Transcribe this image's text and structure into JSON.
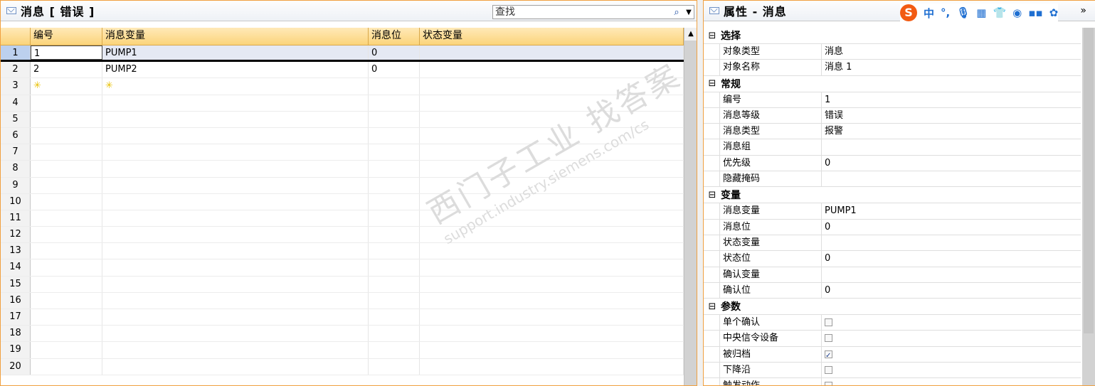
{
  "left": {
    "title": "消息 [ 错误 ]",
    "search_placeholder": "查找",
    "columns": [
      "编号",
      "消息变量",
      "消息位",
      "状态变量"
    ],
    "rows": [
      {
        "n": "1",
        "no": "1",
        "var": "PUMP1",
        "bit": "0",
        "state": ""
      },
      {
        "n": "2",
        "no": "2",
        "var": "PUMP2",
        "bit": "0",
        "state": ""
      },
      {
        "n": "3",
        "no": "",
        "var": "",
        "bit": "",
        "state": ""
      },
      {
        "n": "4"
      },
      {
        "n": "5"
      },
      {
        "n": "6"
      },
      {
        "n": "7"
      },
      {
        "n": "8"
      },
      {
        "n": "9"
      },
      {
        "n": "10"
      },
      {
        "n": "11"
      },
      {
        "n": "12"
      },
      {
        "n": "13"
      },
      {
        "n": "14"
      },
      {
        "n": "15"
      },
      {
        "n": "16"
      },
      {
        "n": "17"
      },
      {
        "n": "18"
      },
      {
        "n": "19"
      },
      {
        "n": "20"
      }
    ],
    "watermark_main": "西门子工业",
    "watermark_right": "找答案",
    "watermark_url": "support.industry.siemens.com/cs"
  },
  "right": {
    "title": "属性 - 消息",
    "ime": [
      "中",
      "°,",
      "🎙",
      "▦",
      "👕",
      "◉",
      "▪▪",
      "✿"
    ],
    "ime_logo": "S",
    "sections": [
      {
        "label": "选择",
        "rows": [
          {
            "k": "对象类型",
            "v": "消息"
          },
          {
            "k": "对象名称",
            "v": "消息 1"
          }
        ]
      },
      {
        "label": "常规",
        "rows": [
          {
            "k": "编号",
            "v": "1"
          },
          {
            "k": "消息等级",
            "v": "错误"
          },
          {
            "k": "消息类型",
            "v": "报警"
          },
          {
            "k": "消息组",
            "v": ""
          },
          {
            "k": "优先级",
            "v": "0"
          },
          {
            "k": "隐藏掩码",
            "v": ""
          }
        ]
      },
      {
        "label": "变量",
        "rows": [
          {
            "k": "消息变量",
            "v": "PUMP1"
          },
          {
            "k": "消息位",
            "v": "0"
          },
          {
            "k": "状态变量",
            "v": ""
          },
          {
            "k": "状态位",
            "v": "0"
          },
          {
            "k": "确认变量",
            "v": ""
          },
          {
            "k": "确认位",
            "v": "0"
          }
        ]
      },
      {
        "label": "参数",
        "rows": [
          {
            "k": "单个确认",
            "check": false
          },
          {
            "k": "中央信令设备",
            "check": false
          },
          {
            "k": "被归档",
            "check": true
          },
          {
            "k": "下降沿",
            "check": false
          },
          {
            "k": "触发动作",
            "check": false
          }
        ]
      }
    ]
  }
}
